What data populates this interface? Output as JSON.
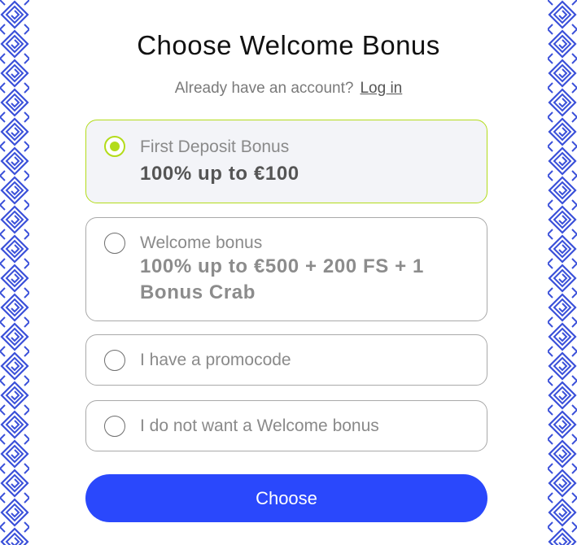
{
  "header": {
    "title": "Choose Welcome Bonus",
    "login_prompt": "Already have an account?",
    "login_link": "Log in"
  },
  "options": [
    {
      "label": "First Deposit Bonus",
      "value": "100% up to €100",
      "selected": true
    },
    {
      "label": "Welcome bonus",
      "value": "100% up to €500 + 200 FS + 1 Bonus Crab",
      "selected": false
    },
    {
      "label": "I have a promocode",
      "selected": false
    },
    {
      "label": "I do not want a Welcome bonus",
      "selected": false
    }
  ],
  "actions": {
    "choose_label": "Choose"
  },
  "colors": {
    "accent_blue": "#2a48fc",
    "selected_green": "#b3dc1a",
    "border_pattern": "#3a50d9"
  }
}
